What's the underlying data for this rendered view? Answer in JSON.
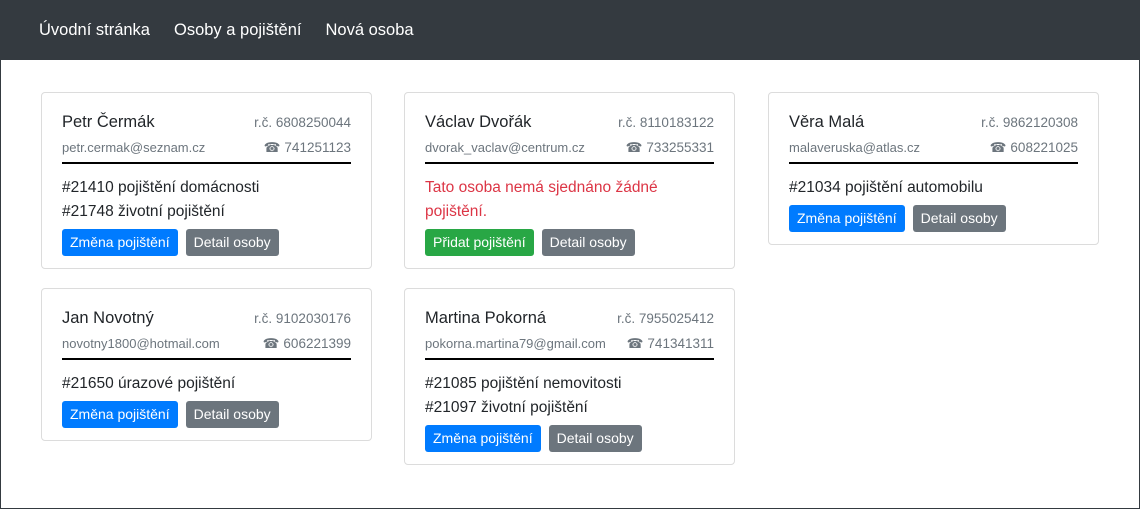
{
  "nav": {
    "home": "Úvodní stránka",
    "people": "Osoby a pojištění",
    "new_person": "Nová osoba"
  },
  "icons": {
    "phone": "☎"
  },
  "colors": {
    "navbar": "#343a40",
    "primary": "#007bff",
    "secondary": "#6c757d",
    "success": "#28a745",
    "danger": "#dc3545"
  },
  "labels": {
    "change_insurance": "Změna pojištění",
    "detail": "Detail osoby",
    "add_insurance": "Přidat pojištění"
  },
  "people": [
    {
      "name": "Petr Čermák",
      "rc": "r.č. 6808250044",
      "email": "petr.cermak@seznam.cz",
      "phone": "741251123",
      "policies": [
        "#21410 pojištění domácnosti",
        "#21748 životní pojištění"
      ]
    },
    {
      "name": "Václav Dvořák",
      "rc": "r.č. 8110183122",
      "email": "dvorak_vaclav@centrum.cz",
      "phone": "733255331",
      "no_policy_message": "Tato osoba nemá sjednáno žádné pojištění."
    },
    {
      "name": "Věra Malá",
      "rc": "r.č. 9862120308",
      "email": "malaveruska@atlas.cz",
      "phone": "608221025",
      "policies": [
        "#21034 pojištění automobilu"
      ]
    },
    {
      "name": "Jan Novotný",
      "rc": "r.č. 9102030176",
      "email": "novotny1800@hotmail.com",
      "phone": "606221399",
      "policies": [
        "#21650 úrazové pojištění"
      ]
    },
    {
      "name": "Martina Pokorná",
      "rc": "r.č. 7955025412",
      "email": "pokorna.martina79@gmail.com",
      "phone": "741341311",
      "policies": [
        "#21085 pojištění nemovitosti",
        "#21097 životní pojištění"
      ]
    }
  ]
}
